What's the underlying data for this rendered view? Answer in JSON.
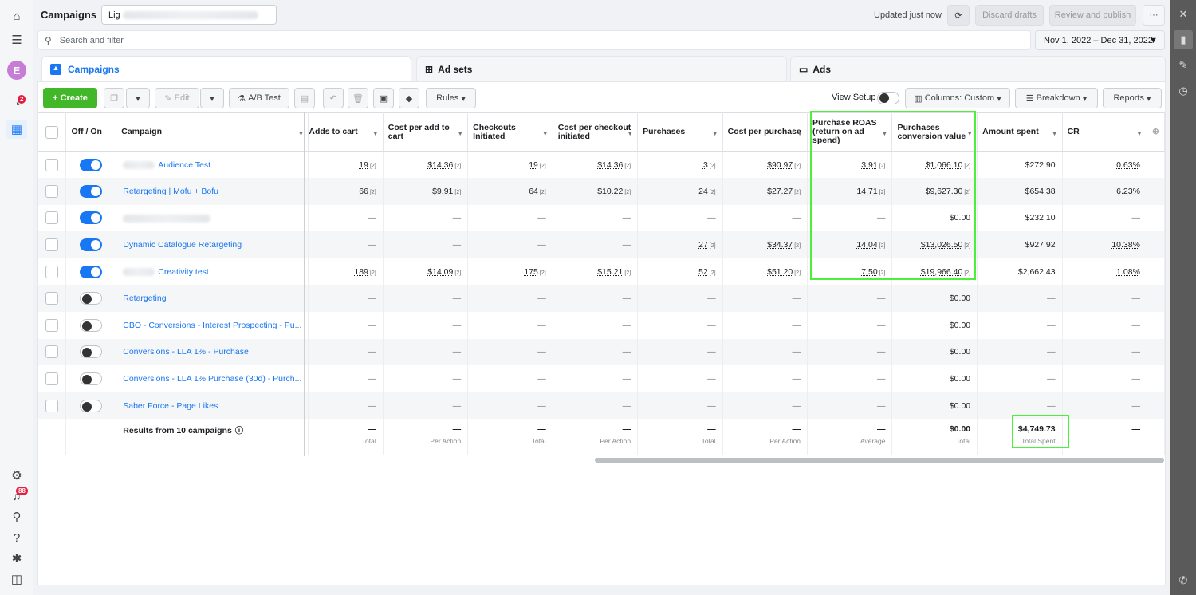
{
  "app": {
    "title": "Campaigns",
    "account_selector": "Lig"
  },
  "topbar": {
    "updated": "Updated just now",
    "discard": "Discard drafts",
    "review": "Review and publish",
    "more": "···"
  },
  "search": {
    "placeholder": "Search and filter"
  },
  "date_range": "Nov 1, 2022 – Dec 31, 2022",
  "tabs": [
    {
      "label": "Campaigns",
      "active": true
    },
    {
      "label": "Ad sets"
    },
    {
      "label": "Ads"
    }
  ],
  "toolbar": {
    "create": "Create",
    "edit": "Edit",
    "ab_test": "A/B Test",
    "rules": "Rules",
    "view_setup": "View Setup",
    "columns": "Columns: Custom",
    "breakdown": "Breakdown",
    "reports": "Reports"
  },
  "leftnav": {
    "avatar": "E",
    "notif_badge": "2",
    "alerts_badge": "88"
  },
  "columns": [
    "Off / On",
    "Campaign",
    "Adds to cart",
    "Cost per add to cart",
    "Checkouts Initiated",
    "Cost per checkout initiated",
    "Purchases",
    "Cost per purchase",
    "Purchase ROAS (return on ad spend)",
    "Purchases conversion value",
    "Amount spent",
    "CR"
  ],
  "rows": [
    {
      "on": true,
      "name": "Audience Test",
      "blurred_prefix": true,
      "adds": "19",
      "cpa": "$14.36",
      "checkouts": "19",
      "cpc": "$14.36",
      "purchases": "3",
      "cpp": "$90.97",
      "roas": "3.91",
      "pcv": "$1,066.10",
      "spent": "$272.90",
      "cr": "0.63%"
    },
    {
      "on": true,
      "name": "Retargeting | Mofu + Bofu",
      "adds": "66",
      "cpa": "$9.91",
      "checkouts": "64",
      "cpc": "$10.22",
      "purchases": "24",
      "cpp": "$27.27",
      "roas": "14.71",
      "pcv": "$9,627.30",
      "spent": "$654.38",
      "cr": "6.23%"
    },
    {
      "on": true,
      "name": "",
      "blurred_full": true,
      "adds": "—",
      "cpa": "—",
      "checkouts": "—",
      "cpc": "—",
      "purchases": "—",
      "cpp": "—",
      "roas": "—",
      "pcv": "$0.00",
      "spent": "$232.10",
      "cr": "—"
    },
    {
      "on": true,
      "name": "Dynamic Catalogue Retargeting",
      "adds": "—",
      "cpa": "—",
      "checkouts": "—",
      "cpc": "—",
      "purchases": "27",
      "cpp": "$34.37",
      "roas": "14.04",
      "pcv": "$13,026.50",
      "spent": "$927.92",
      "cr": "10.38%"
    },
    {
      "on": true,
      "name": "Creativity test",
      "blurred_prefix": true,
      "adds": "189",
      "cpa": "$14.09",
      "checkouts": "175",
      "cpc": "$15.21",
      "purchases": "52",
      "cpp": "$51.20",
      "roas": "7.50",
      "pcv": "$19,966.40",
      "spent": "$2,662.43",
      "cr": "1.08%"
    },
    {
      "on": false,
      "name": "Retargeting",
      "adds": "—",
      "cpa": "—",
      "checkouts": "—",
      "cpc": "—",
      "purchases": "—",
      "cpp": "—",
      "roas": "—",
      "pcv": "$0.00",
      "spent": "—",
      "cr": "—"
    },
    {
      "on": false,
      "name": "CBO - Conversions - Interest Prospecting - Pu...",
      "adds": "—",
      "cpa": "—",
      "checkouts": "—",
      "cpc": "—",
      "purchases": "—",
      "cpp": "—",
      "roas": "—",
      "pcv": "$0.00",
      "spent": "—",
      "cr": "—"
    },
    {
      "on": false,
      "name": "Conversions - LLA 1% - Purchase",
      "adds": "—",
      "cpa": "—",
      "checkouts": "—",
      "cpc": "—",
      "purchases": "—",
      "cpp": "—",
      "roas": "—",
      "pcv": "$0.00",
      "spent": "—",
      "cr": "—"
    },
    {
      "on": false,
      "name": "Conversions - LLA 1% Purchase (30d) - Purch...",
      "adds": "—",
      "cpa": "—",
      "checkouts": "—",
      "cpc": "—",
      "purchases": "—",
      "cpp": "—",
      "roas": "—",
      "pcv": "$0.00",
      "spent": "—",
      "cr": "—"
    },
    {
      "on": false,
      "name": "Saber Force - Page Likes",
      "adds": "—",
      "cpa": "—",
      "checkouts": "—",
      "cpc": "—",
      "purchases": "—",
      "cpp": "—",
      "roas": "—",
      "pcv": "$0.00",
      "spent": "—",
      "cr": "—"
    }
  ],
  "summary": {
    "label": "Results from 10 campaigns",
    "cells": [
      {
        "v": "—",
        "s": "Total"
      },
      {
        "v": "—",
        "s": "Per Action"
      },
      {
        "v": "—",
        "s": "Total"
      },
      {
        "v": "—",
        "s": "Per Action"
      },
      {
        "v": "—",
        "s": "Total"
      },
      {
        "v": "—",
        "s": "Per Action"
      },
      {
        "v": "—",
        "s": "Average"
      },
      {
        "v": "$0.00",
        "s": "Total"
      },
      {
        "v": "$4,749.73",
        "s": "Total Spent"
      },
      {
        "v": "—",
        "s": ""
      }
    ]
  }
}
